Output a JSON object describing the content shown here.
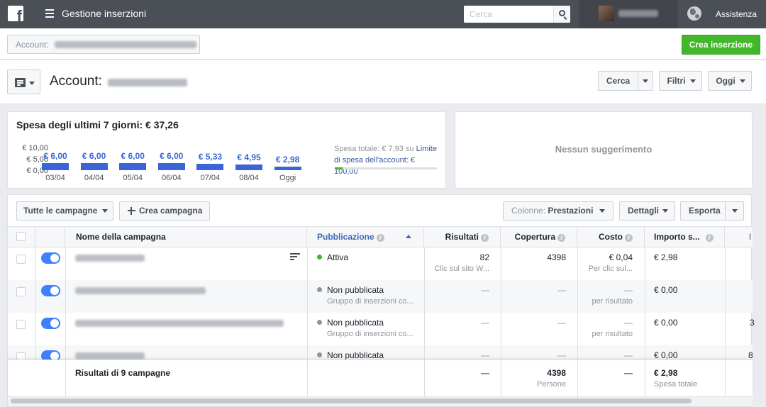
{
  "topbar": {
    "title": "Gestione inserzioni",
    "search_placeholder": "Cerca",
    "help": "Assistenza",
    "brand_color": "#4b4f56"
  },
  "account_row": {
    "select_label": "Account:",
    "create_ad_button": "Crea inserzione"
  },
  "header": {
    "title": "Account:",
    "search_button": "Cerca",
    "filters_button": "Filtri",
    "date_button": "Oggi"
  },
  "spend_card": {
    "title": "Spesa degli ultimi 7 giorni: € 37,26",
    "y_ticks": [
      "€ 10,00",
      "€ 5,00",
      "€ 0,00"
    ],
    "bars": [
      {
        "date": "03/04",
        "label": "€ 6,00",
        "value": 6.0
      },
      {
        "date": "04/04",
        "label": "€ 6,00",
        "value": 6.0
      },
      {
        "date": "05/04",
        "label": "€ 6,00",
        "value": 6.0
      },
      {
        "date": "06/04",
        "label": "€ 6,00",
        "value": 6.0
      },
      {
        "date": "07/04",
        "label": "€ 5,33",
        "value": 5.33
      },
      {
        "date": "08/04",
        "label": "€ 4,95",
        "value": 4.95
      },
      {
        "date": "Oggi",
        "label": "€ 2,98",
        "value": 2.98
      }
    ],
    "total_prefix": "Spesa totale: € 7,93 su",
    "total_link": "Limite di spesa dell'account: € 100,00",
    "limit_progress": 0.0793,
    "bar_color": "#3b65d6"
  },
  "suggestions": {
    "text": "Nessun suggerimento"
  },
  "table": {
    "toolbar": {
      "all_campaigns": "Tutte le campagne",
      "create_campaign": "Crea campagna",
      "columns_prefix": "Colonne:",
      "columns_value": "Prestazioni",
      "details": "Dettagli",
      "export": "Esporta"
    },
    "headers": {
      "name": "Nome della campagna",
      "delivery": "Pubblicazione",
      "results": "Risultati",
      "reach": "Copertura",
      "cost": "Costo",
      "amount": "Importo s..."
    },
    "rows": [
      {
        "delivery": "Attiva",
        "delivery_sub": "",
        "status_color": "#42b72a",
        "results": "82",
        "results_sub": "Clic sul sito W...",
        "reach": "4398",
        "cost": "€ 0,04",
        "cost_sub": "Per clic sul...",
        "amount": "€ 2,98",
        "extra": ""
      },
      {
        "delivery": "Non pubblicata",
        "delivery_sub": "Gruppo di inserzioni co...",
        "status_color": "#90949c",
        "results": "—",
        "results_sub": "",
        "reach": "—",
        "cost": "—",
        "cost_sub": "per risultato",
        "amount": "€ 0,00",
        "extra": ""
      },
      {
        "delivery": "Non pubblicata",
        "delivery_sub": "Gruppo di inserzioni co...",
        "status_color": "#90949c",
        "results": "—",
        "results_sub": "",
        "reach": "—",
        "cost": "—",
        "cost_sub": "per risultato",
        "amount": "€ 0,00",
        "extra": "3"
      },
      {
        "delivery": "Non pubblicata",
        "delivery_sub": "",
        "status_color": "#90949c",
        "results": "—",
        "results_sub": "",
        "reach": "—",
        "cost": "—",
        "cost_sub": "",
        "amount": "€ 0,00",
        "extra": "8"
      }
    ],
    "footer": {
      "label": "Risultati di 9 campagne",
      "results": "—",
      "reach": "4398",
      "reach_sub": "Persone",
      "cost": "—",
      "amount": "€ 2,98",
      "amount_sub": "Spesa totale"
    }
  }
}
